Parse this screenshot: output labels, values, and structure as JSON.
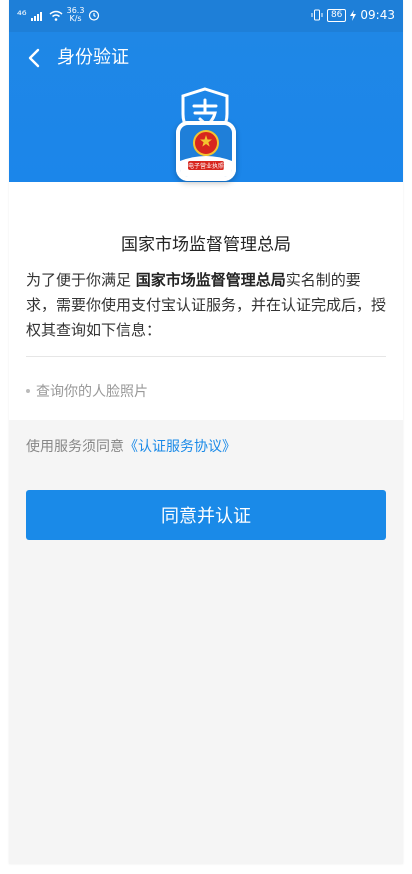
{
  "status_bar": {
    "signal": "⁴⁶",
    "speed_value": "36.3",
    "speed_unit": "K/s",
    "battery": "86",
    "time": "09:43"
  },
  "header": {
    "title": "身份验证"
  },
  "org": {
    "name": "国家市场监督管理总局",
    "logo_caption": "电子营业执照"
  },
  "description": {
    "part1": "为了便于你满足 ",
    "org_bold": "国家市场监督管理总局",
    "part2": "实名制的要求，需要你使用支付宝认证服务，并在认证完成后，授权其查询如下信息："
  },
  "info_items": [
    "查询你的人脸照片"
  ],
  "agreement": {
    "prefix": "使用服务须同意",
    "link": "《认证服务协议》"
  },
  "button": {
    "label": "同意并认证"
  },
  "colors": {
    "primary": "#1a8ae8",
    "header_bg": "#1f87e6"
  }
}
